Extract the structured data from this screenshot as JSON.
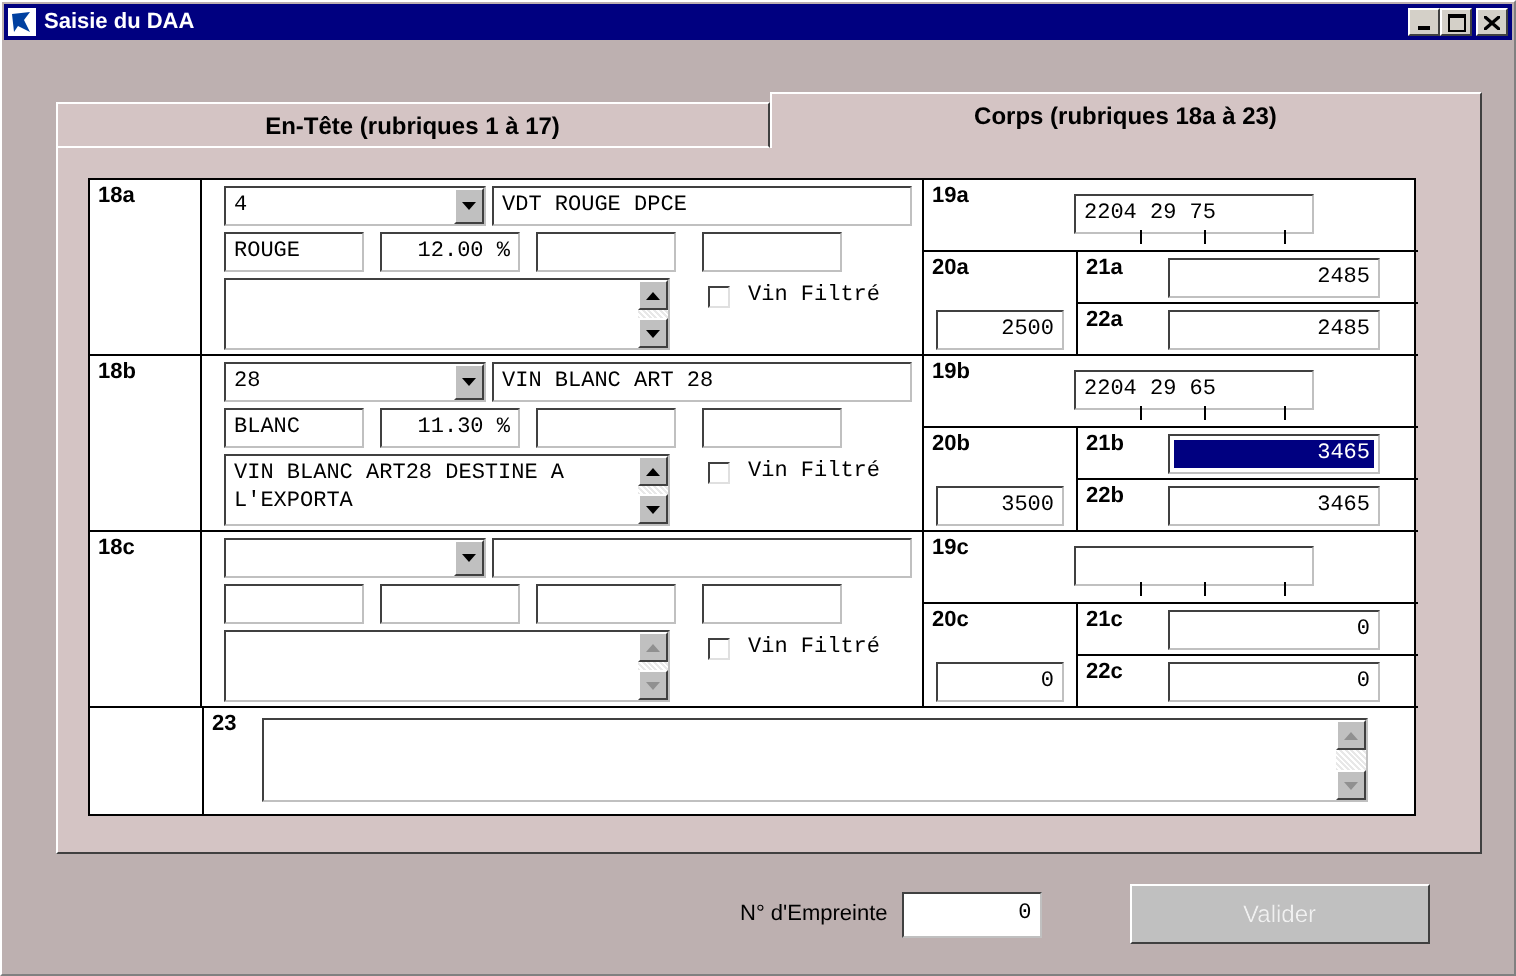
{
  "window": {
    "title": "Saisie du DAA"
  },
  "tabs": [
    {
      "label": "En-Tête (rubriques 1 à 17)",
      "selected": false
    },
    {
      "label": "Corps (rubriques 18a à 23)",
      "selected": true
    }
  ],
  "items": [
    {
      "label": "18a",
      "code": "4",
      "description": "VDT ROUGE DPCE",
      "colour": "ROUGE",
      "strength": "12.00 %",
      "note_disabled": false,
      "vin_filtre": {
        "label": "Vin Filtré",
        "checked": false
      },
      "f19": {
        "label": "19a",
        "value": "2204 29 75"
      },
      "f20": {
        "label": "20a",
        "value": "2500"
      },
      "f21": {
        "label": "21a",
        "value": "2485",
        "selected": false
      },
      "f22": {
        "label": "22a",
        "value": "2485",
        "selected": false
      }
    },
    {
      "label": "18b",
      "code": "28",
      "description": "VIN BLANC ART 28",
      "colour": "BLANC",
      "strength": "11.30 %",
      "note": "VIN BLANC ART28 DESTINE A L'EXPORTA",
      "note_disabled": false,
      "vin_filtre": {
        "label": "Vin Filtré",
        "checked": false
      },
      "f19": {
        "label": "19b",
        "value": "2204 29 65"
      },
      "f20": {
        "label": "20b",
        "value": "3500"
      },
      "f21": {
        "label": "21b",
        "value": "3465",
        "selected": true
      },
      "f22": {
        "label": "22b",
        "value": "3465",
        "selected": false
      }
    },
    {
      "label": "18c",
      "note_disabled": true,
      "vin_filtre": {
        "label": "Vin Filtré",
        "checked": false
      },
      "f19": {
        "label": "19c"
      },
      "f20": {
        "label": "20c",
        "value": "0"
      },
      "f21": {
        "label": "21c",
        "value": "0",
        "selected": false
      },
      "f22": {
        "label": "22c",
        "value": "0",
        "selected": false
      }
    }
  ],
  "box23": {
    "label": "23",
    "disabled": true
  },
  "footer": {
    "empreinte_label": "N° d'Empreinte",
    "empreinte_value": "0",
    "submit": {
      "label": "Valider",
      "disabled": true
    }
  }
}
